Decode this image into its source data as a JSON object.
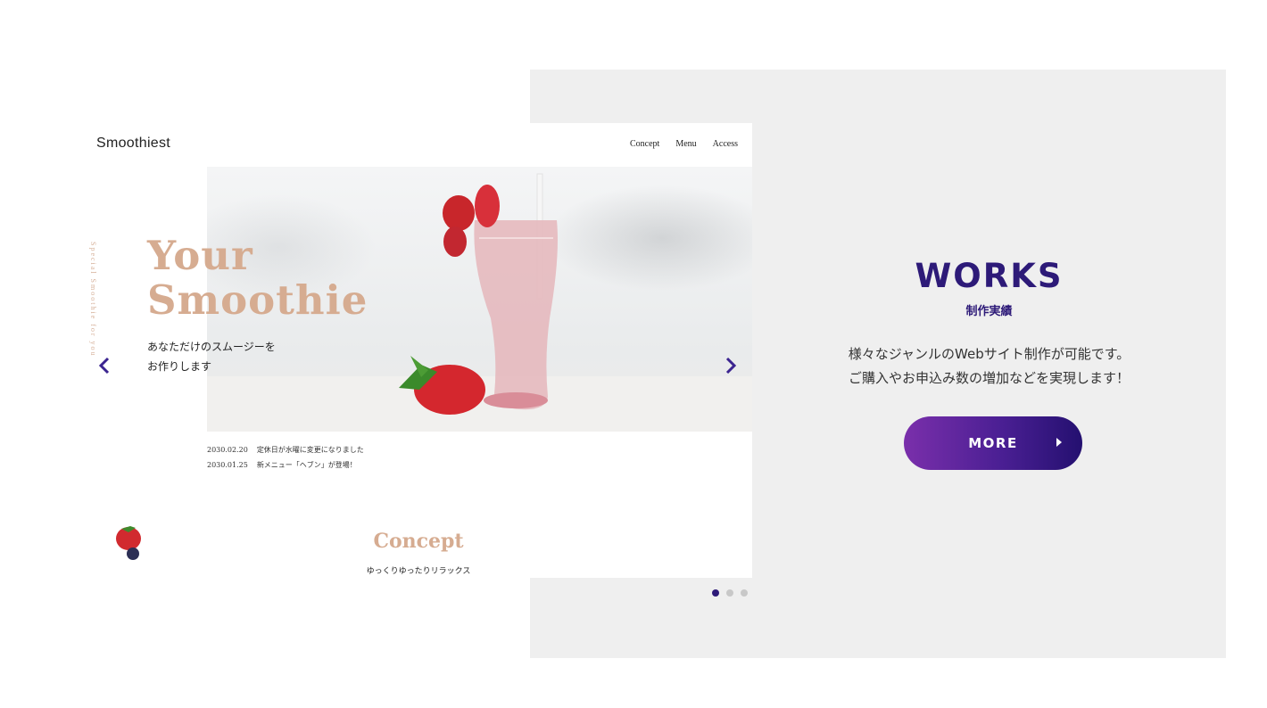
{
  "site": {
    "logo": "Smoothiest",
    "nav": [
      "Concept",
      "Menu",
      "Access"
    ],
    "vertical_text": "Special Smoothie for you",
    "hero_title_line1": "Your",
    "hero_title_line2": "Smoothie",
    "hero_sub_line1": "あなただけのスムージーを",
    "hero_sub_line2": "お作りします",
    "news": [
      {
        "date": "2030.02.20",
        "text": "定休日が水曜に変更になりました"
      },
      {
        "date": "2030.01.25",
        "text": "新メニュー「ヘブン」が登場！"
      }
    ],
    "concept_title": "Concept",
    "concept_sub": "ゆっくりゆったりリラックス"
  },
  "works": {
    "title": "WORKS",
    "subtitle": "制作実績",
    "desc_line1": "様々なジャンルのWebサイト制作が可能です。",
    "desc_line2": "ご購入やお申込み数の増加などを実現します！",
    "button_label": "MORE"
  },
  "pagination": {
    "total": 3,
    "active": 1
  },
  "colors": {
    "accent": "#2d1a78",
    "title_beige": "#d6ac91",
    "panel_bg": "#efefef"
  }
}
